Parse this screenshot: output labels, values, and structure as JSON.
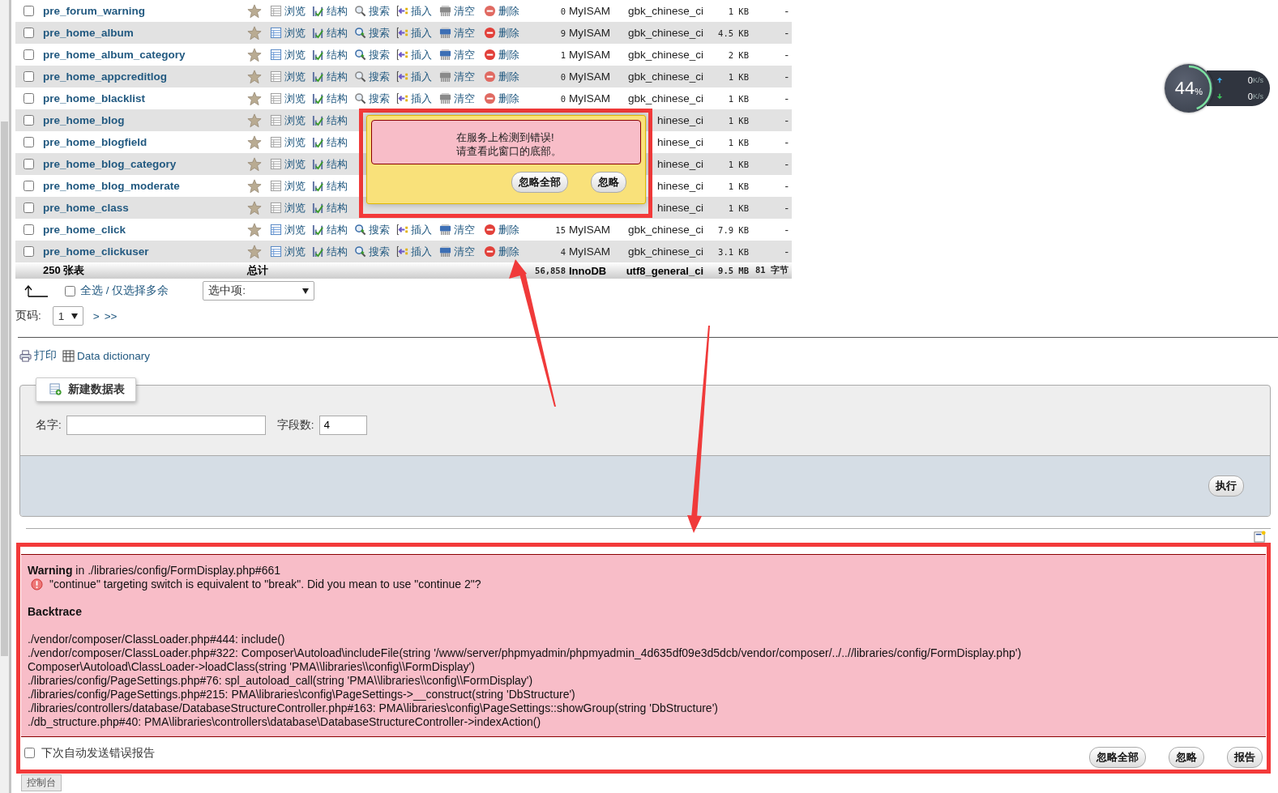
{
  "tables": [
    {
      "name": "pre_forum_warning",
      "checked": false,
      "empty": true,
      "actions": [
        {
          "kind": "browse",
          "label": "浏览"
        },
        {
          "kind": "structure",
          "label": "结构"
        },
        {
          "kind": "search",
          "label": "搜索"
        },
        {
          "kind": "insert",
          "label": "插入"
        },
        {
          "kind": "empty",
          "label": "清空"
        },
        {
          "kind": "drop",
          "label": "删除"
        }
      ],
      "rows": "0",
      "engine": "MyISAM",
      "collation": "gbk_chinese_ci",
      "size": "1 KB",
      "overhead": "-"
    },
    {
      "name": "pre_home_album",
      "checked": false,
      "empty": false,
      "actions": [
        {
          "kind": "browse",
          "label": "浏览"
        },
        {
          "kind": "structure",
          "label": "结构"
        },
        {
          "kind": "search",
          "label": "搜索"
        },
        {
          "kind": "insert",
          "label": "插入"
        },
        {
          "kind": "empty",
          "label": "清空"
        },
        {
          "kind": "drop",
          "label": "删除"
        }
      ],
      "rows": "9",
      "engine": "MyISAM",
      "collation": "gbk_chinese_ci",
      "size": "4.5 KB",
      "overhead": "-"
    },
    {
      "name": "pre_home_album_category",
      "checked": false,
      "empty": false,
      "actions": [
        {
          "kind": "browse",
          "label": "浏览"
        },
        {
          "kind": "structure",
          "label": "结构"
        },
        {
          "kind": "search",
          "label": "搜索"
        },
        {
          "kind": "insert",
          "label": "插入"
        },
        {
          "kind": "empty",
          "label": "清空"
        },
        {
          "kind": "drop",
          "label": "删除"
        }
      ],
      "rows": "1",
      "engine": "MyISAM",
      "collation": "gbk_chinese_ci",
      "size": "2 KB",
      "overhead": "-"
    },
    {
      "name": "pre_home_appcreditlog",
      "checked": false,
      "empty": true,
      "actions": [
        {
          "kind": "browse",
          "label": "浏览"
        },
        {
          "kind": "structure",
          "label": "结构"
        },
        {
          "kind": "search",
          "label": "搜索"
        },
        {
          "kind": "insert",
          "label": "插入"
        },
        {
          "kind": "empty",
          "label": "清空"
        },
        {
          "kind": "drop",
          "label": "删除"
        }
      ],
      "rows": "0",
      "engine": "MyISAM",
      "collation": "gbk_chinese_ci",
      "size": "1 KB",
      "overhead": "-"
    },
    {
      "name": "pre_home_blacklist",
      "checked": false,
      "empty": true,
      "actions": [
        {
          "kind": "browse",
          "label": "浏览"
        },
        {
          "kind": "structure",
          "label": "结构"
        },
        {
          "kind": "search",
          "label": "搜索"
        },
        {
          "kind": "insert",
          "label": "插入"
        },
        {
          "kind": "empty",
          "label": "清空"
        },
        {
          "kind": "drop",
          "label": "删除"
        }
      ],
      "rows": "0",
      "engine": "MyISAM",
      "collation": "gbk_chinese_ci",
      "size": "1 KB",
      "overhead": "-"
    },
    {
      "name": "pre_home_blog",
      "checked": false,
      "empty": true,
      "actions": [
        {
          "kind": "browse",
          "label": "浏览"
        },
        {
          "kind": "structure",
          "label": "结构"
        }
      ],
      "collation": "hinese_ci",
      "size": "1 KB",
      "overhead": "-"
    },
    {
      "name": "pre_home_blogfield",
      "checked": false,
      "empty": true,
      "actions": [
        {
          "kind": "browse",
          "label": "浏览"
        },
        {
          "kind": "structure",
          "label": "结构"
        }
      ],
      "collation": "hinese_ci",
      "size": "1 KB",
      "overhead": "-"
    },
    {
      "name": "pre_home_blog_category",
      "checked": false,
      "empty": true,
      "actions": [
        {
          "kind": "browse",
          "label": "浏览"
        },
        {
          "kind": "structure",
          "label": "结构"
        }
      ],
      "collation": "hinese_ci",
      "size": "1 KB",
      "overhead": "-"
    },
    {
      "name": "pre_home_blog_moderate",
      "checked": false,
      "empty": true,
      "actions": [
        {
          "kind": "browse",
          "label": "浏览"
        },
        {
          "kind": "structure",
          "label": "结构"
        }
      ],
      "collation": "hinese_ci",
      "size": "1 KB",
      "overhead": "-"
    },
    {
      "name": "pre_home_class",
      "checked": false,
      "empty": true,
      "actions": [
        {
          "kind": "browse",
          "label": "浏览"
        },
        {
          "kind": "structure",
          "label": "结构"
        }
      ],
      "collation": "hinese_ci",
      "size": "1 KB",
      "overhead": "-"
    },
    {
      "name": "pre_home_click",
      "checked": false,
      "empty": false,
      "actions": [
        {
          "kind": "browse",
          "label": "浏览"
        },
        {
          "kind": "structure",
          "label": "结构"
        },
        {
          "kind": "search",
          "label": "搜索"
        },
        {
          "kind": "insert",
          "label": "插入"
        },
        {
          "kind": "empty",
          "label": "清空"
        },
        {
          "kind": "drop",
          "label": "删除"
        }
      ],
      "rows": "15",
      "engine": "MyISAM",
      "collation": "gbk_chinese_ci",
      "size": "7.9 KB",
      "overhead": "-"
    },
    {
      "name": "pre_home_clickuser",
      "checked": false,
      "empty": false,
      "actions": [
        {
          "kind": "browse",
          "label": "浏览"
        },
        {
          "kind": "structure",
          "label": "结构"
        },
        {
          "kind": "search",
          "label": "搜索"
        },
        {
          "kind": "insert",
          "label": "插入"
        },
        {
          "kind": "empty",
          "label": "清空"
        },
        {
          "kind": "drop",
          "label": "删除"
        }
      ],
      "rows": "4",
      "engine": "MyISAM",
      "collation": "gbk_chinese_ci",
      "size": "3.1 KB",
      "overhead": "-"
    }
  ],
  "totals": {
    "count": "250 张表",
    "label": "总计",
    "rows": "56,858",
    "engine": "InnoDB",
    "collation": "utf8_general_ci",
    "size": "9.5 MB",
    "overhead": "81 字节"
  },
  "bulk": {
    "checked": false,
    "label": "全选 / 仅选择多余",
    "with_selected": "选中项:"
  },
  "pager": {
    "label": "页码:",
    "page": "1",
    "links": [
      ">",
      ">>"
    ]
  },
  "links": [
    {
      "kind": "print",
      "label": "打印"
    },
    {
      "kind": "dictionary",
      "label": "Data dictionary"
    }
  ],
  "create": {
    "legend": "新建数据表",
    "name_label": "名字:",
    "columns_label": "字段数:",
    "columns_value": "4",
    "submit": "执行"
  },
  "dialog": {
    "message": [
      "在服务上检测到错误!",
      "请查看此窗口的底部。"
    ],
    "buttons": [
      "忽略全部",
      "忽略"
    ]
  },
  "error": {
    "warning_line": "**Warning** in ./libraries/config/FormDisplay.php#661",
    "message": "\"continue\" targeting switch is equivalent to \"break\". Did you mean to use \"continue 2\"?",
    "backtrace_title": "Backtrace",
    "backtrace": [
      "./vendor/composer/ClassLoader.php#444: include()",
      "./vendor/composer/ClassLoader.php#322: Composer\\Autoload\\includeFile(string '/www/server/phpmyadmin/phpmyadmin_4d635df09e3d5dcb/vendor/composer/../..//libraries/config/FormDisplay.php')",
      "Composer\\Autoload\\ClassLoader->loadClass(string 'PMA\\\\libraries\\\\config\\\\FormDisplay')",
      "./libraries/config/PageSettings.php#76: spl_autoload_call(string 'PMA\\\\libraries\\\\config\\\\FormDisplay')",
      "./libraries/config/PageSettings.php#215: PMA\\libraries\\config\\PageSettings->__construct(string 'DbStructure')",
      "./libraries/controllers/database/DatabaseStructureController.php#163: PMA\\libraries\\config\\PageSettings::showGroup(string 'DbStructure')",
      "./db_structure.php#40: PMA\\libraries\\controllers\\database\\DatabaseStructureController->indexAction()"
    ],
    "auto_send_checked": false,
    "auto_send_label": "下次自动发送错误报告",
    "buttons": [
      "忽略全部",
      "忽略",
      "报告"
    ]
  },
  "console_tab": "控制台",
  "monitor": {
    "cpu": "44",
    "unit": "%",
    "level": 0.44,
    "upload": {
      "value": "0",
      "unit": "K/s"
    },
    "download": {
      "value": "0",
      "unit": "K/s"
    }
  }
}
